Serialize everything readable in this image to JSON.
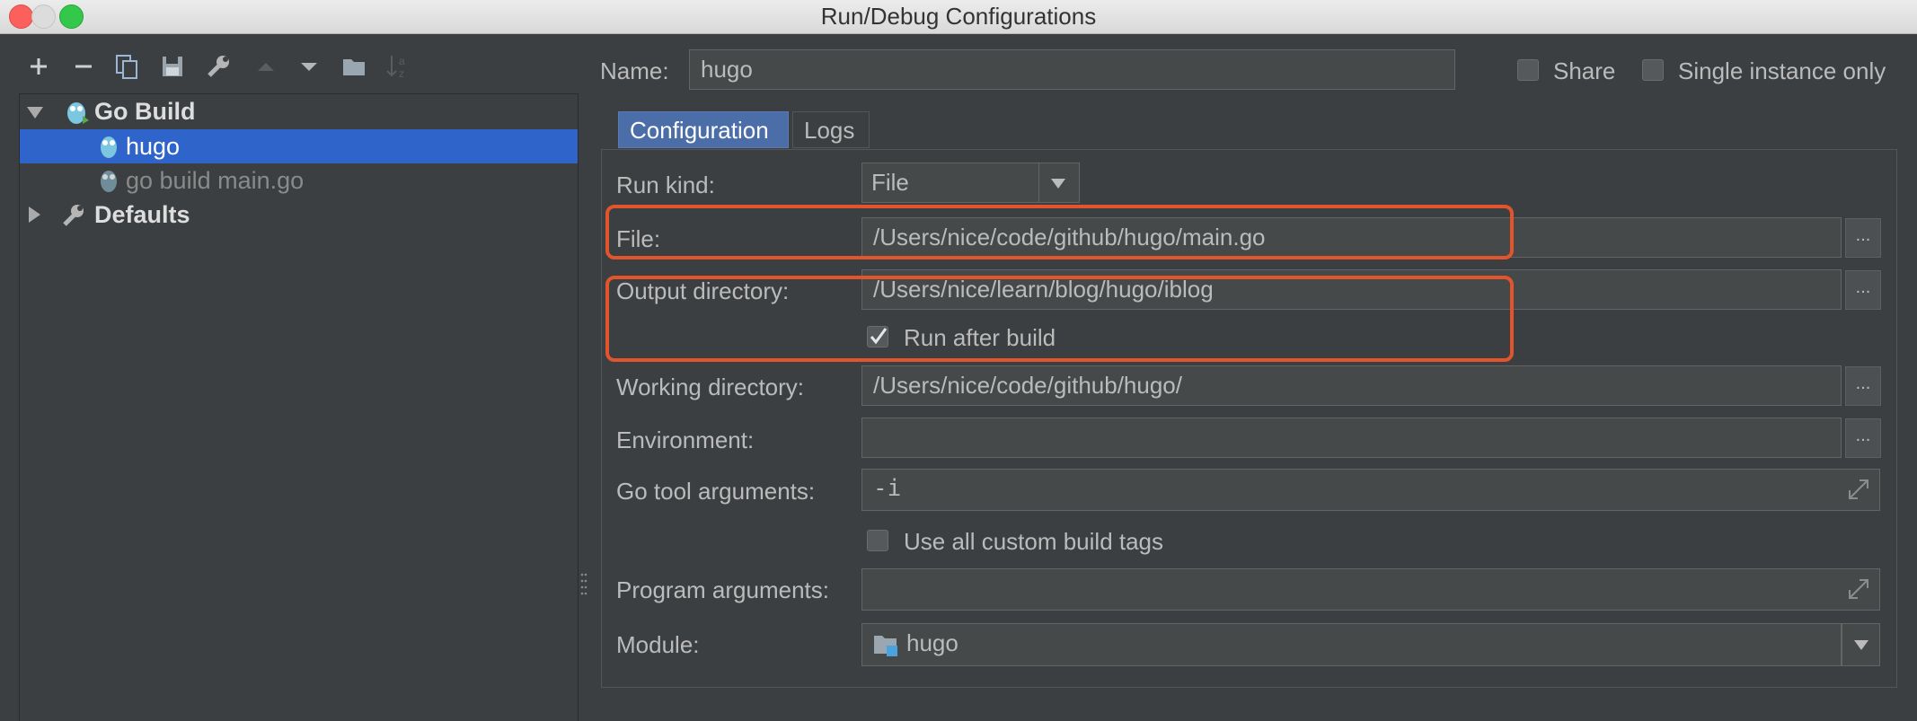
{
  "window": {
    "title": "Run/Debug Configurations"
  },
  "toolbar": {
    "icons": [
      "add-icon",
      "remove-icon",
      "copy-icon",
      "save-icon",
      "wrench-icon",
      "move-up-icon",
      "move-down-icon",
      "folder-icon",
      "sort-icon"
    ]
  },
  "tree": {
    "go_build": "Go Build",
    "hugo": "hugo",
    "go_build_main": "go build main.go",
    "defaults": "Defaults"
  },
  "header": {
    "name_label": "Name:",
    "name_value": "hugo",
    "share_label": "Share",
    "single_instance_label": "Single instance only"
  },
  "tabs": [
    {
      "label": "Configuration",
      "active": true
    },
    {
      "label": "Logs",
      "active": false
    }
  ],
  "form": {
    "run_kind_label": "Run kind:",
    "run_kind_value": "File",
    "file_label": "File:",
    "file_value": "/Users/nice/code/github/hugo/main.go",
    "output_dir_label": "Output directory:",
    "output_dir_value": "/Users/nice/learn/blog/hugo/iblog",
    "run_after_build_label": "Run after build",
    "run_after_build_checked": true,
    "working_dir_label": "Working directory:",
    "working_dir_value": "/Users/nice/code/github/hugo/",
    "environment_label": "Environment:",
    "environment_value": "",
    "go_tool_args_label": "Go tool arguments:",
    "go_tool_args_value": "-i",
    "custom_tags_label": "Use all custom build tags",
    "custom_tags_checked": false,
    "program_args_label": "Program arguments:",
    "program_args_value": "",
    "module_label": "Module:",
    "module_value": "hugo",
    "browse_label": "..."
  },
  "colors": {
    "background": "#3c3f41",
    "selection": "#2f65ca",
    "highlight": "#e2542b",
    "field_bg": "#45494a"
  }
}
